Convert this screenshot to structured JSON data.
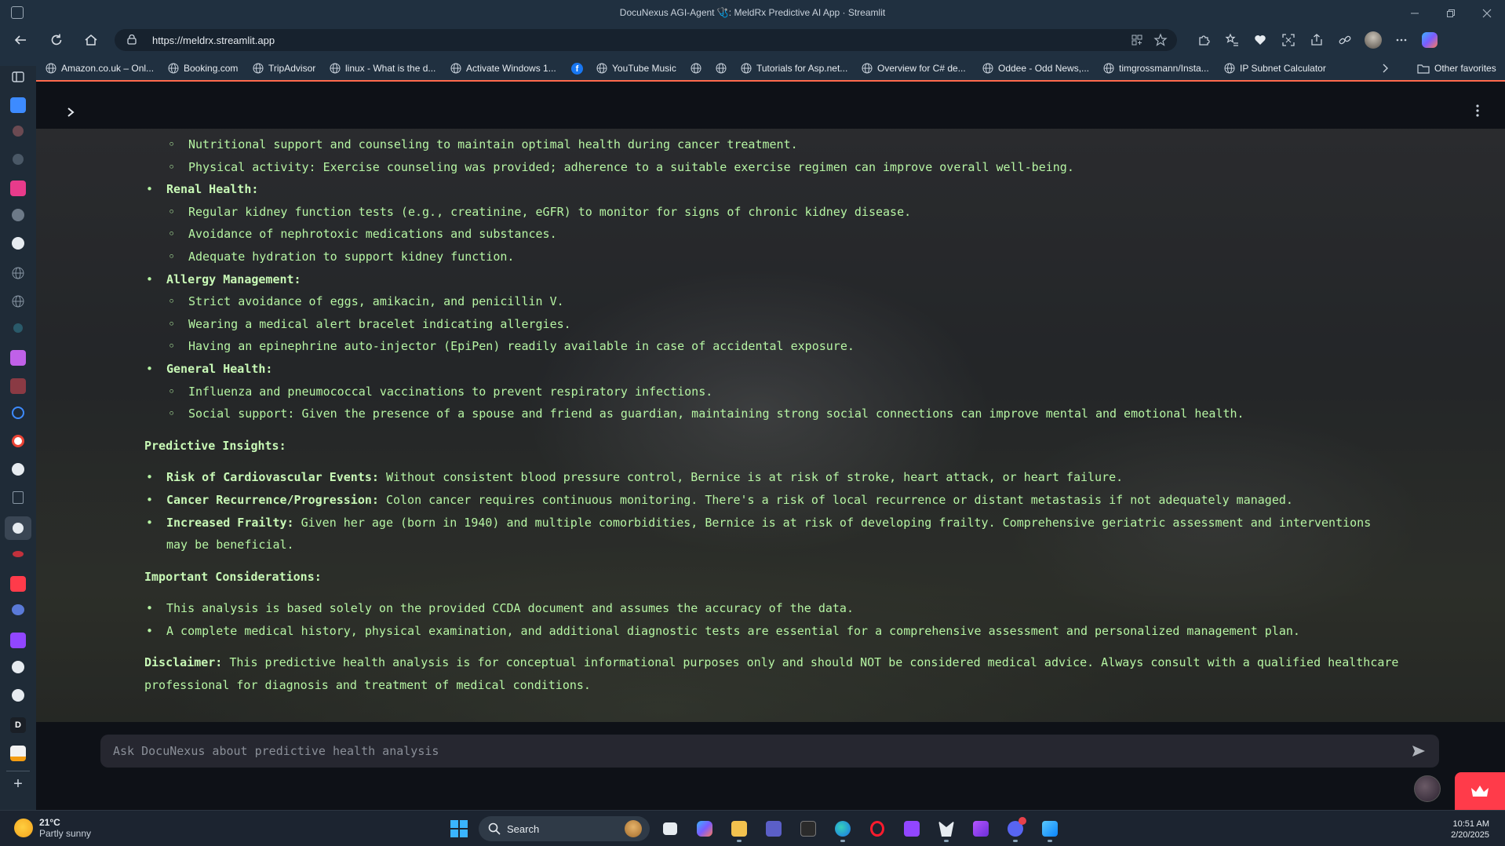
{
  "window": {
    "title": "DocuNexus AGI-Agent 🩺: MeldRx Predictive AI App · Streamlit"
  },
  "browser": {
    "url": "https://meldrx.streamlit.app",
    "bookmarks": [
      "Amazon.co.uk – Onl...",
      "Booking.com",
      "TripAdvisor",
      "linux - What is the d...",
      "Activate Windows 1...",
      "YouTube Music",
      "Tutorials for Asp.net...",
      "Overview for C# de...",
      "Oddee - Odd News,...",
      "timgrossmann/Insta...",
      "IP Subnet Calculator"
    ],
    "other_favorites": "Other favorites"
  },
  "content": {
    "items": [
      {
        "level": 2,
        "text": "Nutritional support and counseling to maintain optimal health during cancer treatment."
      },
      {
        "level": 2,
        "text": "Physical activity: Exercise counseling was provided; adherence to a suitable exercise regimen can improve overall well-being."
      },
      {
        "level": 1,
        "bold": "Renal Health:",
        "text": ""
      },
      {
        "level": 2,
        "text": "Regular kidney function tests (e.g., creatinine, eGFR) to monitor for signs of chronic kidney disease."
      },
      {
        "level": 2,
        "text": "Avoidance of nephrotoxic medications and substances."
      },
      {
        "level": 2,
        "text": "Adequate hydration to support kidney function."
      },
      {
        "level": 1,
        "bold": "Allergy Management:",
        "text": ""
      },
      {
        "level": 2,
        "text": "Strict avoidance of eggs, amikacin, and penicillin V."
      },
      {
        "level": 2,
        "text": "Wearing a medical alert bracelet indicating allergies."
      },
      {
        "level": 2,
        "text": "Having an epinephrine auto-injector (EpiPen) readily available in case of accidental exposure."
      },
      {
        "level": 1,
        "bold": "General Health:",
        "text": ""
      },
      {
        "level": 2,
        "text": "Influenza and pneumococcal vaccinations to prevent respiratory infections."
      },
      {
        "level": 2,
        "text": "Social support: Given the presence of a spouse and friend as guardian, maintaining strong social connections can improve mental and emotional health."
      }
    ],
    "predictive_heading": "Predictive Insights:",
    "predictive": [
      {
        "bold": "Risk of Cardiovascular Events:",
        "text": " Without consistent blood pressure control, Bernice is at risk of stroke, heart attack, or heart failure."
      },
      {
        "bold": "Cancer Recurrence/Progression:",
        "text": " Colon cancer requires continuous monitoring. There's a risk of local recurrence or distant metastasis if not adequately managed."
      },
      {
        "bold": "Increased Frailty:",
        "text": " Given her age (born in 1940) and multiple comorbidities, Bernice is at risk of developing frailty. Comprehensive geriatric assessment and interventions may be beneficial."
      }
    ],
    "considerations_heading": "Important Considerations:",
    "considerations": [
      "This analysis is based solely on the provided CCDA document and assumes the accuracy of the data.",
      "A complete medical history, physical examination, and additional diagnostic tests are essential for a comprehensive assessment and personalized management plan."
    ],
    "disclaimer_label": "Disclaimer:",
    "disclaimer_text": " This predictive health analysis is for conceptual informational purposes only and should NOT be considered medical advice. Always consult with a qualified healthcare professional for diagnosis and treatment of medical conditions."
  },
  "chat": {
    "placeholder": "Ask DocuNexus about predictive health analysis"
  },
  "taskbar": {
    "temperature": "21°C",
    "condition": "Partly sunny",
    "search_label": "Search",
    "time": "10:51 AM",
    "date": "2/20/2025"
  },
  "colors": {
    "text_green": "#b6f5a3",
    "accent_red": "#ff3b4a",
    "chrome": "#203040"
  }
}
